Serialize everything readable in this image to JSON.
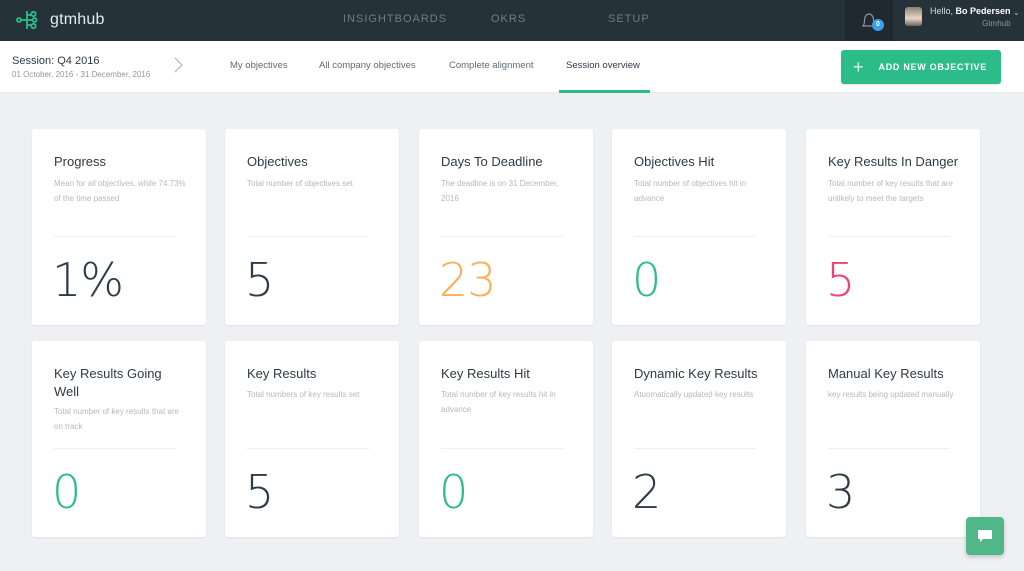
{
  "header": {
    "brand": "gtmhub",
    "nav": [
      {
        "label": "INSIGHTBOARDS"
      },
      {
        "label": "OKRS"
      },
      {
        "label": "SETUP"
      }
    ],
    "notifications": {
      "icon": "bell-icon",
      "count": "0"
    },
    "user": {
      "greeting_prefix": "Hello, ",
      "name": "Bo Pedersen",
      "org": "Gtmhub"
    }
  },
  "session": {
    "title": "Session: Q4 2016",
    "dates": "01 October, 2016 - 31 December, 2016"
  },
  "tabs": [
    {
      "label": "My objectives",
      "active": false
    },
    {
      "label": "All company objectives",
      "active": false
    },
    {
      "label": "Complete alignment",
      "active": false
    },
    {
      "label": "Session overview",
      "active": true
    }
  ],
  "actions": {
    "add_objective": "ADD NEW OBJECTIVE"
  },
  "colors": {
    "accent": "#2bbc8a",
    "topbar": "#26323a",
    "value_default": "#2e3a45",
    "value_orange": "#f6b15a",
    "value_green": "#2bbc8a",
    "value_red": "#f0426e"
  },
  "cards": [
    {
      "title": "Progress",
      "description": "Mean for all objectives, while 74.73% of the time passed",
      "value": "1%",
      "tone": "default"
    },
    {
      "title": "Objectives",
      "description": "Total number of objectives set",
      "value": "5",
      "tone": "default"
    },
    {
      "title": "Days To Deadline",
      "description": "The deadline is on 31 December, 2016",
      "value": "23",
      "tone": "orange"
    },
    {
      "title": "Objectives Hit",
      "description": "Total number of objectives hit in advance",
      "value": "0",
      "tone": "green"
    },
    {
      "title": "Key Results In Danger",
      "description": "Total number of key results that are unlikely to meet the targets",
      "value": "5",
      "tone": "red"
    },
    {
      "title": "Key Results Going Well",
      "description": "Total number of key results that are on track",
      "value": "0",
      "tone": "green"
    },
    {
      "title": "Key Results",
      "description": "Total numbers of key results set",
      "value": "5",
      "tone": "default"
    },
    {
      "title": "Key Results Hit",
      "description": "Total number of key results hit in advance",
      "value": "0",
      "tone": "green"
    },
    {
      "title": "Dynamic Key Results",
      "description": "Atuomatically updated key results",
      "value": "2",
      "tone": "default"
    },
    {
      "title": "Manual Key Results",
      "description": "key results being updated manually",
      "value": "3",
      "tone": "default"
    }
  ]
}
